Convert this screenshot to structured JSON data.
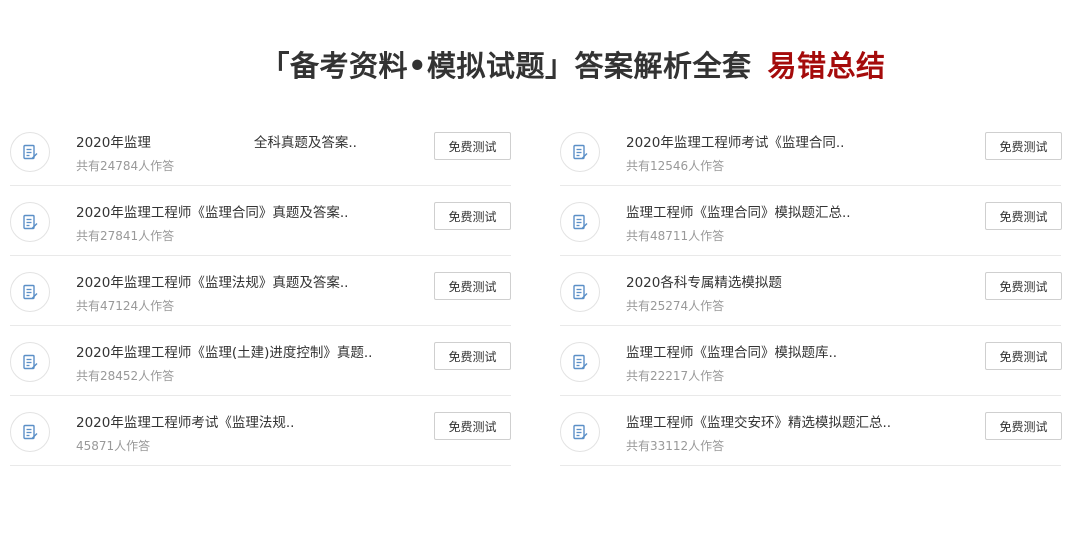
{
  "header": {
    "title": "「备考资料•模拟试题」答案解析全套",
    "accent": "易错总结",
    "accent_color": "#a50b0b"
  },
  "left": [
    {
      "title": "2020年监理                        全科真题及答案..",
      "count": "共有24784人作答",
      "button": "免费测试",
      "icon": "edit-document-icon"
    },
    {
      "title": "2020年监理工程师《监理合同》真题及答案..",
      "count": "共有27841人作答",
      "button": "免费测试",
      "icon": "edit-document-icon"
    },
    {
      "title": "2020年监理工程师《监理法规》真题及答案..",
      "count": "共有47124人作答",
      "button": "免费测试",
      "icon": "edit-document-icon"
    },
    {
      "title": "2020年监理工程师《监理(土建)进度控制》真题..",
      "count": "共有28452人作答",
      "button": "免费测试",
      "icon": "edit-document-icon"
    },
    {
      "title": "2020年监理工程师考试《监理法规..",
      "count": "45871人作答",
      "button": "免费测试",
      "icon": "edit-document-icon"
    }
  ],
  "right": [
    {
      "title": "2020年监理工程师考试《监理合同..",
      "count": "共有12546人作答",
      "button": "免费测试",
      "icon": "edit-document-icon"
    },
    {
      "title": "监理工程师《监理合同》模拟题汇总..",
      "count": "共有48711人作答",
      "button": "免费测试",
      "icon": "edit-document-icon"
    },
    {
      "title": "2020各科专属精选模拟题",
      "count": "共有25274人作答",
      "button": "免费测试",
      "icon": "edit-document-icon"
    },
    {
      "title": "监理工程师《监理合同》模拟题库..",
      "count": "共有22217人作答",
      "button": "免费测试",
      "icon": "edit-document-icon"
    },
    {
      "title": "监理工程师《监理交安环》精选模拟题汇总..",
      "count": "共有33112人作答",
      "button": "免费测试",
      "icon": "edit-document-icon"
    }
  ]
}
